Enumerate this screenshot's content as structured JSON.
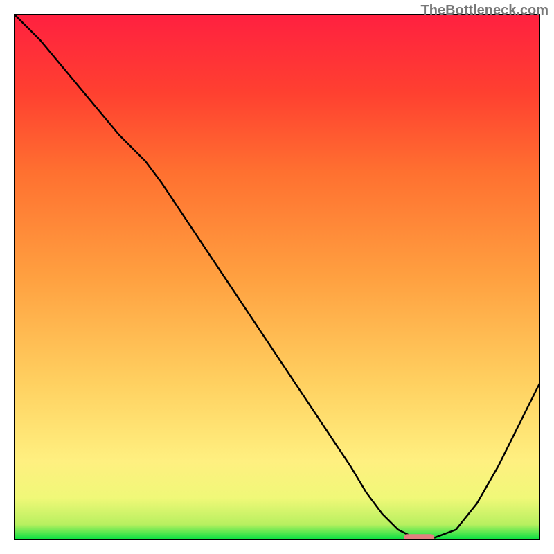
{
  "watermark": "TheBottleneck.com",
  "chart_data": {
    "type": "line",
    "title": "",
    "xlabel": "",
    "ylabel": "",
    "xlim": [
      0,
      100
    ],
    "ylim": [
      0,
      100
    ],
    "x": [
      0,
      5,
      10,
      15,
      20,
      25,
      28,
      32,
      36,
      40,
      44,
      48,
      52,
      56,
      60,
      64,
      67,
      70,
      73,
      76,
      80,
      84,
      88,
      92,
      96,
      100
    ],
    "values": [
      100,
      95,
      89,
      83,
      77,
      72,
      68,
      62,
      56,
      50,
      44,
      38,
      32,
      26,
      20,
      14,
      9,
      5,
      2,
      0.5,
      0.5,
      2,
      7,
      14,
      22,
      30
    ],
    "marker": {
      "x": 77,
      "y": 0.5
    },
    "gradient_stops": [
      {
        "offset": 0,
        "color": "#00e040"
      },
      {
        "offset": 3,
        "color": "#b8f060"
      },
      {
        "offset": 8,
        "color": "#f0f878"
      },
      {
        "offset": 15,
        "color": "#fff080"
      },
      {
        "offset": 30,
        "color": "#ffd060"
      },
      {
        "offset": 50,
        "color": "#ffa040"
      },
      {
        "offset": 70,
        "color": "#ff7030"
      },
      {
        "offset": 85,
        "color": "#ff4030"
      },
      {
        "offset": 100,
        "color": "#ff2040"
      }
    ]
  }
}
